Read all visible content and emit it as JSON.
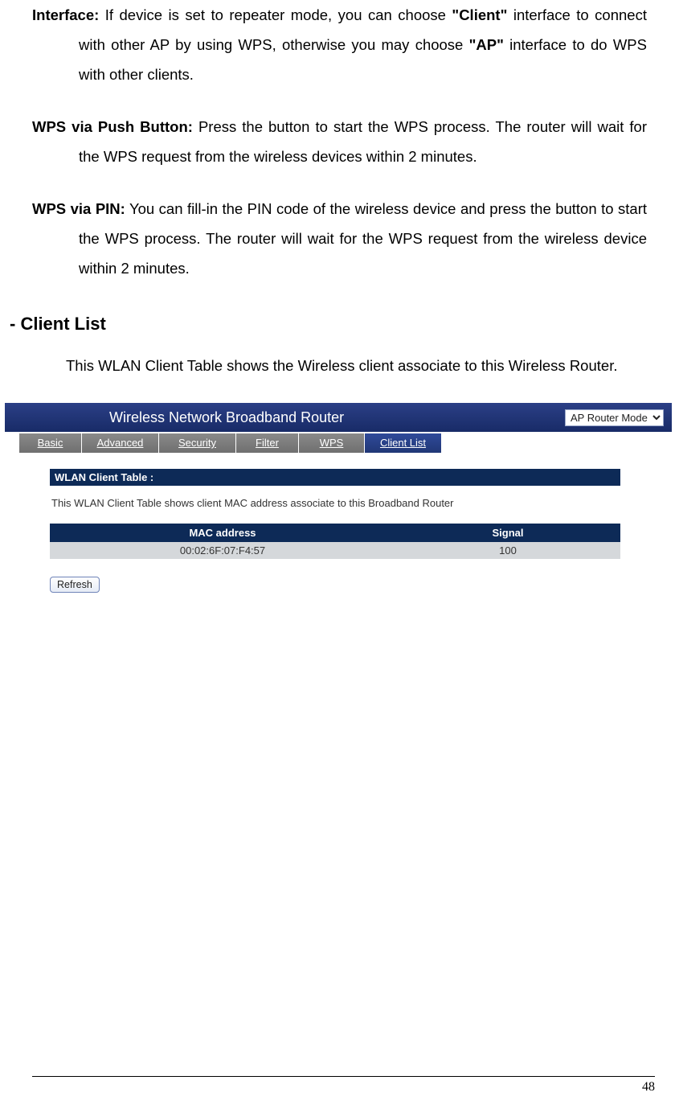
{
  "defs": {
    "interface": {
      "label": "Interface:",
      "text_a": " If device is set to repeater mode, you can choose ",
      "client": "\"Client\"",
      "text_b": " interface to connect with other AP by using WPS, otherwise you may choose ",
      "ap": "\"AP\"",
      "text_c": " interface to do WPS with other clients."
    },
    "push": {
      "label": "WPS via Push Button:",
      "text": " Press the button to start the WPS process. The router will wait for the WPS request from the wireless devices within 2 minutes."
    },
    "pin": {
      "label": "WPS via PIN:",
      "text": " You can fill-in the PIN code of the wireless device and press the button to start the WPS process. The router will wait for the WPS request from the wireless device within 2 minutes."
    }
  },
  "heading": "- Client List",
  "intro": "This WLAN Client Table shows the Wireless client associate to this Wireless Router.",
  "router": {
    "title": "Wireless Network Broadband Router",
    "mode_options": [
      "AP Router Mode"
    ],
    "mode_selected": "AP Router Mode",
    "tabs": [
      "Basic",
      "Advanced",
      "Security",
      "Filter",
      "WPS",
      "Client List"
    ],
    "active_tab": "Client List",
    "section_title": "WLAN Client Table :",
    "section_desc": "This WLAN Client Table shows client MAC address associate to this Broadband Router",
    "table": {
      "headers": [
        "MAC address",
        "Signal"
      ],
      "rows": [
        {
          "mac": "00:02:6F:07:F4:57",
          "signal": "100"
        }
      ]
    },
    "refresh_label": "Refresh"
  },
  "page_number": "48"
}
